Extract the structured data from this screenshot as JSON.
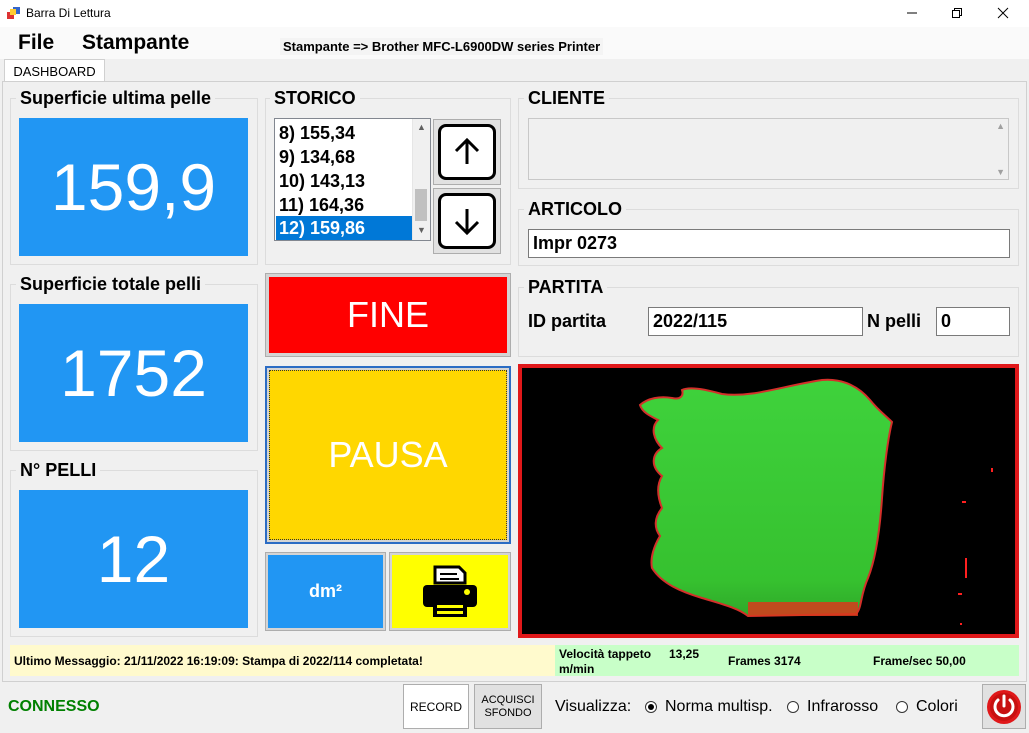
{
  "window": {
    "title": "Barra Di Lettura"
  },
  "menu": {
    "file": "File",
    "stampante": "Stampante",
    "printer_info": "Stampante => Brother MFC-L6900DW series Printer"
  },
  "tabs": [
    {
      "label": "DASHBOARD",
      "active": true
    }
  ],
  "superficie_ultima": {
    "label": "Superficie ultima pelle",
    "value": "159,9"
  },
  "superficie_totale": {
    "label": "Superficie totale pelli",
    "value": "1752"
  },
  "n_pelli": {
    "label": "N° PELLI",
    "value": "12"
  },
  "storico": {
    "label": "STORICO",
    "items": [
      "8) 155,34",
      "9) 134,68",
      "10) 143,13",
      "11) 164,36",
      "12) 159,86"
    ],
    "selected_index": 4
  },
  "buttons": {
    "fine": "FINE",
    "pausa": "PAUSA",
    "unit": "dm²",
    "record": "RECORD",
    "acquisci": "ACQUISCI SFONDO"
  },
  "cliente": {
    "label": "CLIENTE",
    "value": ""
  },
  "articolo": {
    "label": "ARTICOLO",
    "value": "Impr 0273"
  },
  "partita": {
    "label": "PARTITA",
    "id_label": "ID partita",
    "id_value": "2022/115",
    "n_pelli_label": "N pelli",
    "n_pelli_value": "0"
  },
  "status": {
    "message": "Ultimo Messaggio: 21/11/2022 16:19:09: Stampa di 2022/114 completata!",
    "velocita_label": "Velocità tappeto",
    "velocita_value": "13,25",
    "velocita_unit": "m/min",
    "frames": "Frames 3174",
    "fps": "Frame/sec 50,00"
  },
  "footer": {
    "connection": "CONNESSO",
    "visualizza_label": "Visualizza:",
    "options": [
      "Norma multisp.",
      "Infrarosso",
      "Colori"
    ],
    "selected_option": 0
  },
  "colors": {
    "blue": "#2196f3",
    "red": "#ff0000",
    "yellow": "#ffd700",
    "print_bg": "#ffff00",
    "connected": "#008000",
    "image_border": "#e0181a"
  },
  "icons": {
    "up": "arrow-up-icon",
    "down": "arrow-down-icon",
    "printer": "printer-icon",
    "power": "power-icon",
    "app": "app-icon"
  }
}
